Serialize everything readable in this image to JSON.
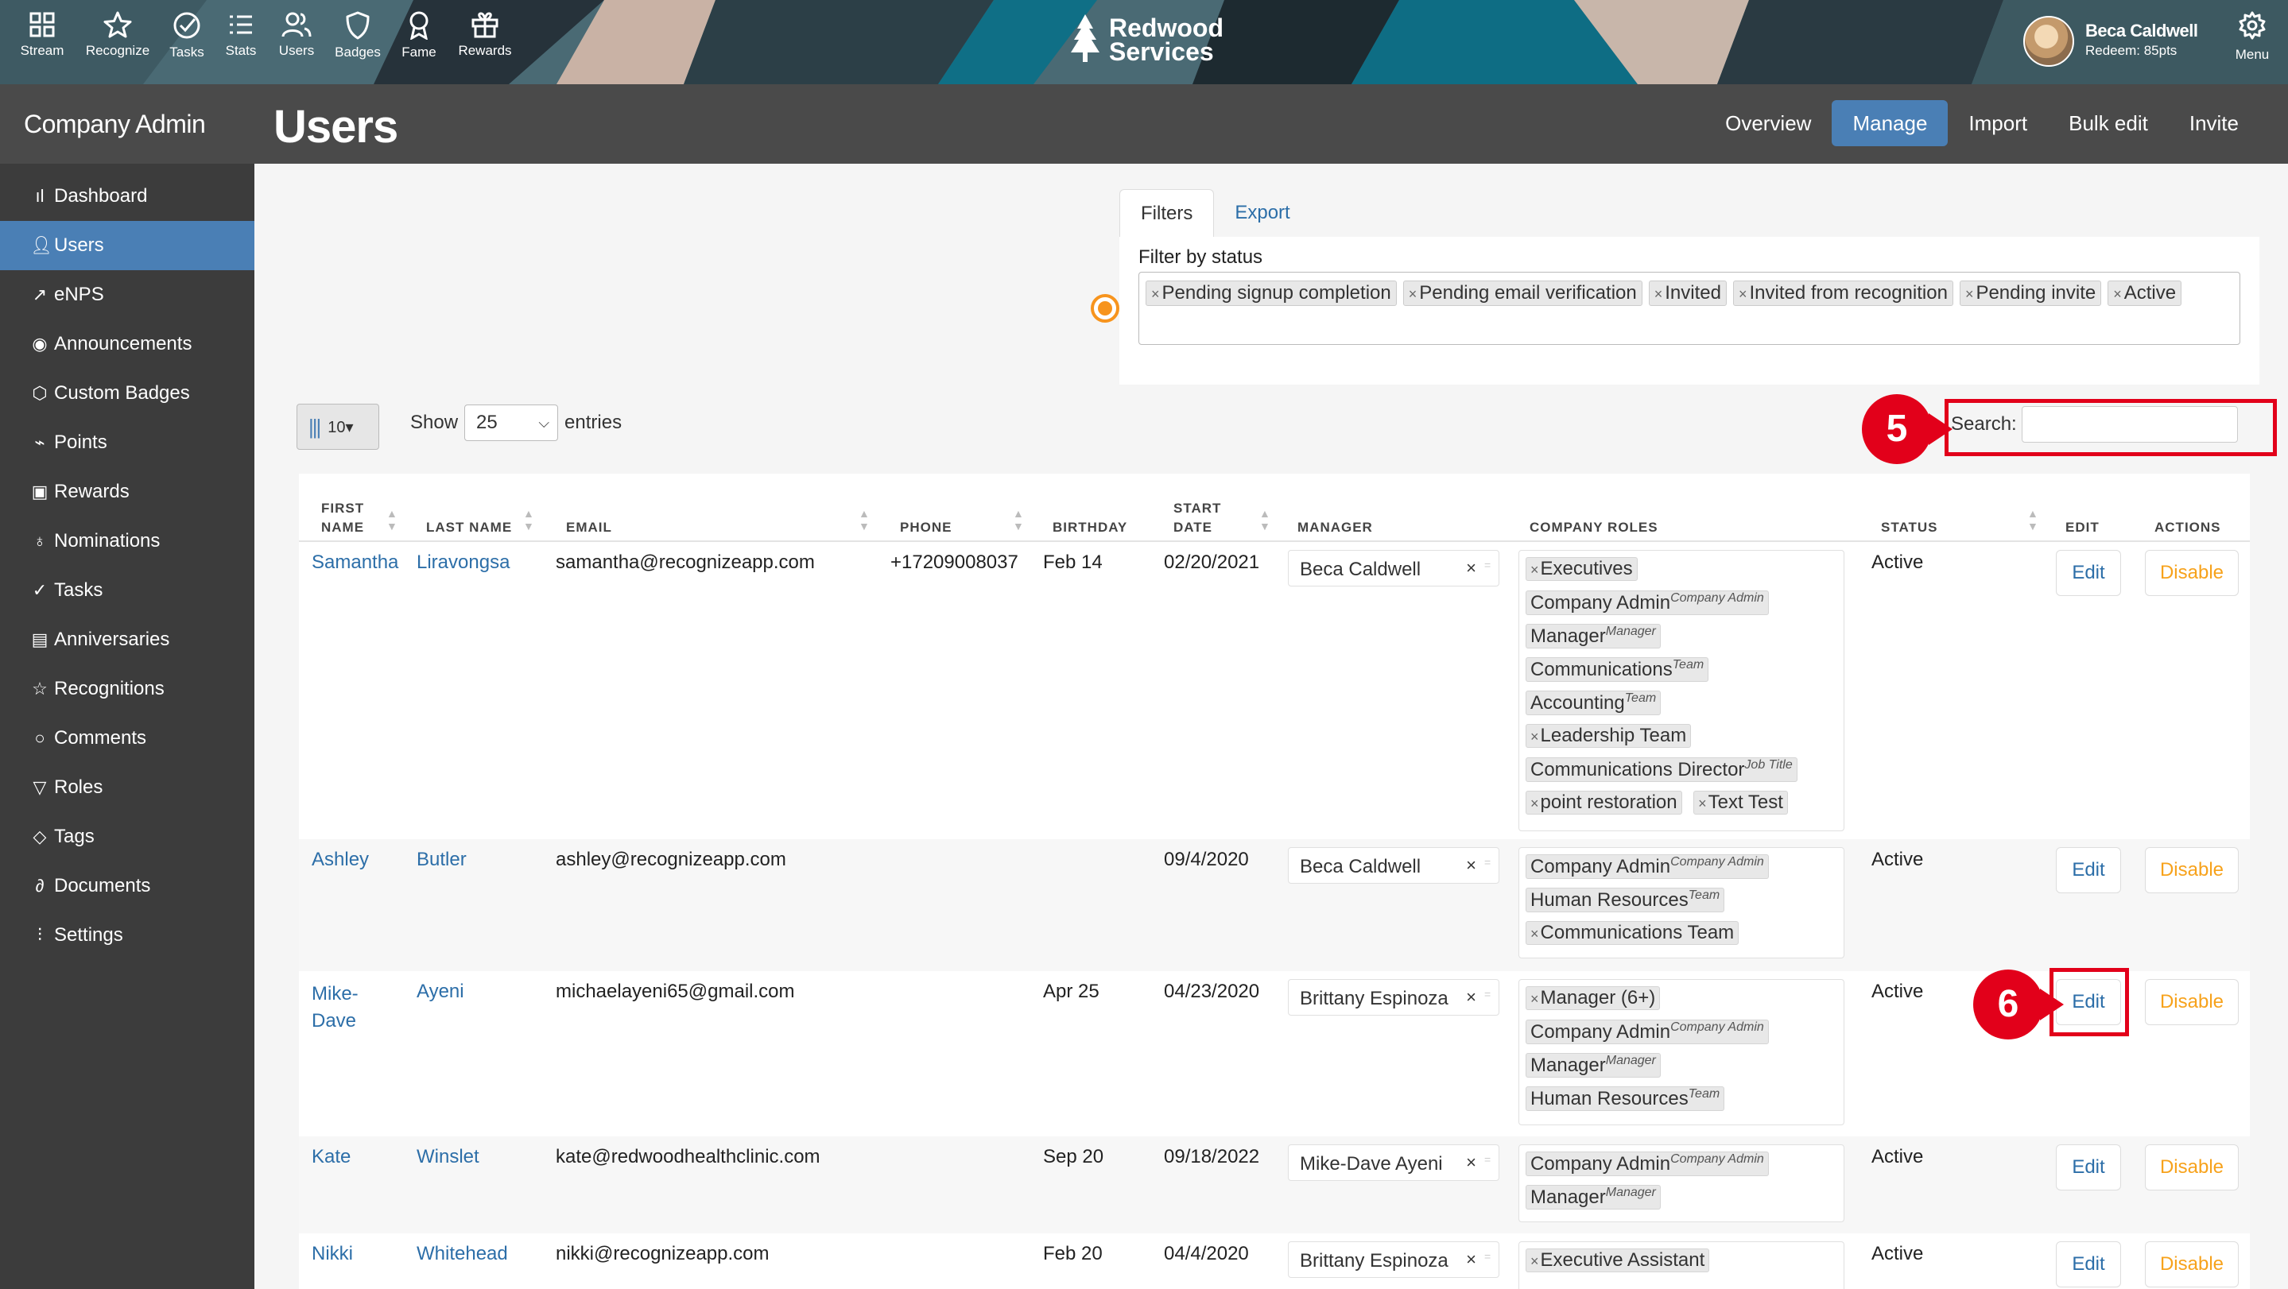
{
  "topnav": {
    "items": [
      {
        "label": "Stream",
        "icon": "grid-icon"
      },
      {
        "label": "Recognize",
        "icon": "star-icon"
      },
      {
        "label": "Tasks",
        "icon": "check-circle-icon"
      },
      {
        "label": "Stats",
        "icon": "list-icon"
      },
      {
        "label": "Users",
        "icon": "users-icon"
      },
      {
        "label": "Badges",
        "icon": "shield-icon"
      },
      {
        "label": "Fame",
        "icon": "award-icon"
      },
      {
        "label": "Rewards",
        "icon": "gift-icon"
      }
    ],
    "brand_line1": "Redwood",
    "brand_line2": "Services",
    "user_name": "Beca Caldwell",
    "user_redeem": "Redeem: 85pts",
    "menu_label": "Menu"
  },
  "sidebar": {
    "title": "Company Admin",
    "items": [
      {
        "label": "Dashboard",
        "icon": "bar-chart-icon"
      },
      {
        "label": "Users",
        "icon": "user-icon",
        "active": true
      },
      {
        "label": "eNPS",
        "icon": "trend-icon"
      },
      {
        "label": "Announcements",
        "icon": "broadcast-icon"
      },
      {
        "label": "Custom Badges",
        "icon": "shield-icon"
      },
      {
        "label": "Points",
        "icon": "activity-icon"
      },
      {
        "label": "Rewards",
        "icon": "gift-icon"
      },
      {
        "label": "Nominations",
        "icon": "award-icon"
      },
      {
        "label": "Tasks",
        "icon": "check-circle-icon"
      },
      {
        "label": "Anniversaries",
        "icon": "calendar-icon"
      },
      {
        "label": "Recognitions",
        "icon": "star-icon"
      },
      {
        "label": "Comments",
        "icon": "comment-icon"
      },
      {
        "label": "Roles",
        "icon": "filter-icon"
      },
      {
        "label": "Tags",
        "icon": "tag-icon"
      },
      {
        "label": "Documents",
        "icon": "paperclip-icon"
      },
      {
        "label": "Settings",
        "icon": "sliders-icon"
      }
    ]
  },
  "header": {
    "title": "Users",
    "tabs": [
      {
        "label": "Overview"
      },
      {
        "label": "Manage",
        "active": true
      },
      {
        "label": "Import"
      },
      {
        "label": "Bulk edit"
      },
      {
        "label": "Invite"
      }
    ]
  },
  "filters": {
    "tab_filters": "Filters",
    "tab_export": "Export",
    "label": "Filter by status",
    "chips": [
      "Pending signup completion",
      "Pending email verification",
      "Invited",
      "Invited from recognition",
      "Pending invite",
      "Active"
    ]
  },
  "toolbar": {
    "colvis_count": "10▾",
    "show_label": "Show",
    "entries_value": "25",
    "entries_label": "entries",
    "search_label": "Search:",
    "search_value": ""
  },
  "annotations": {
    "step5": "5",
    "step6": "6"
  },
  "table": {
    "columns": {
      "first_name": [
        "FIRST",
        "NAME"
      ],
      "last_name": "LAST NAME",
      "email": "EMAIL",
      "phone": "PHONE",
      "birthday": "BIRTHDAY",
      "start_date": [
        "START",
        "DATE"
      ],
      "manager": "MANAGER",
      "company_roles": "COMPANY ROLES",
      "status": "STATUS",
      "edit": "EDIT",
      "actions": "ACTIONS"
    },
    "edit_label": "Edit",
    "disable_label": "Disable",
    "rows": [
      {
        "first": "Samantha",
        "last": "Liravongsa",
        "email": "samantha@recognizeapp.com",
        "phone": "+17209008037",
        "birthday": "Feb 14",
        "start": "02/20/2021",
        "manager": "Beca Caldwell",
        "status": "Active",
        "roles": [
          {
            "name": "Executives",
            "x": true,
            "sub": ""
          },
          {
            "name": "Company Admin",
            "x": false,
            "sub": "Company Admin"
          },
          {
            "name": "Manager",
            "x": false,
            "sub": "Manager"
          },
          {
            "name": "Communications",
            "x": false,
            "sub": "Team"
          },
          {
            "name": "Accounting",
            "x": false,
            "sub": "Team"
          },
          {
            "name": "Leadership Team",
            "x": true,
            "sub": ""
          },
          {
            "name": "Communications Director",
            "x": false,
            "sub": "Job Title"
          },
          {
            "name": "point restoration",
            "x": true,
            "sub": ""
          },
          {
            "name": "Text Test",
            "x": true,
            "sub": ""
          }
        ]
      },
      {
        "first": "Ashley",
        "last": "Butler",
        "email": "ashley@recognizeapp.com",
        "phone": "",
        "birthday": "",
        "start": "09/4/2020",
        "manager": "Beca Caldwell",
        "status": "Active",
        "roles": [
          {
            "name": "Company Admin",
            "x": false,
            "sub": "Company Admin"
          },
          {
            "name": "Human Resources",
            "x": false,
            "sub": "Team"
          },
          {
            "name": "Communications Team",
            "x": true,
            "sub": ""
          }
        ]
      },
      {
        "first": "Mike-Dave",
        "first_line1": "Mike-",
        "first_line2": "Dave",
        "last": "Ayeni",
        "email": "michaelayeni65@gmail.com",
        "phone": "",
        "birthday": "Apr 25",
        "start": "04/23/2020",
        "manager": "Brittany Espinoza",
        "status": "Active",
        "roles": [
          {
            "name": "Manager (6+)",
            "x": true,
            "sub": ""
          },
          {
            "name": "Company Admin",
            "x": false,
            "sub": "Company Admin"
          },
          {
            "name": "Manager",
            "x": false,
            "sub": "Manager"
          },
          {
            "name": "Human Resources",
            "x": false,
            "sub": "Team"
          }
        ]
      },
      {
        "first": "Kate",
        "last": "Winslet",
        "email": "kate@redwoodhealthclinic.com",
        "phone": "",
        "birthday": "Sep 20",
        "start": "09/18/2022",
        "manager": "Mike-Dave Ayeni",
        "status": "Active",
        "roles": [
          {
            "name": "Company Admin",
            "x": false,
            "sub": "Company Admin"
          },
          {
            "name": "Manager",
            "x": false,
            "sub": "Manager"
          }
        ]
      },
      {
        "first": "Nikki",
        "last": "Whitehead",
        "email": "nikki@recognizeapp.com",
        "phone": "",
        "birthday": "Feb 20",
        "start": "04/4/2020",
        "manager": "Brittany Espinoza",
        "status": "Active",
        "roles": [
          {
            "name": "Executive Assistant",
            "x": true,
            "sub": ""
          }
        ]
      }
    ]
  },
  "colors": {
    "accent": "#4a7fb5",
    "link": "#2c6ea8",
    "disable": "#f7a21b",
    "annotation": "#e2001a",
    "status_dot": "#f7941d"
  }
}
